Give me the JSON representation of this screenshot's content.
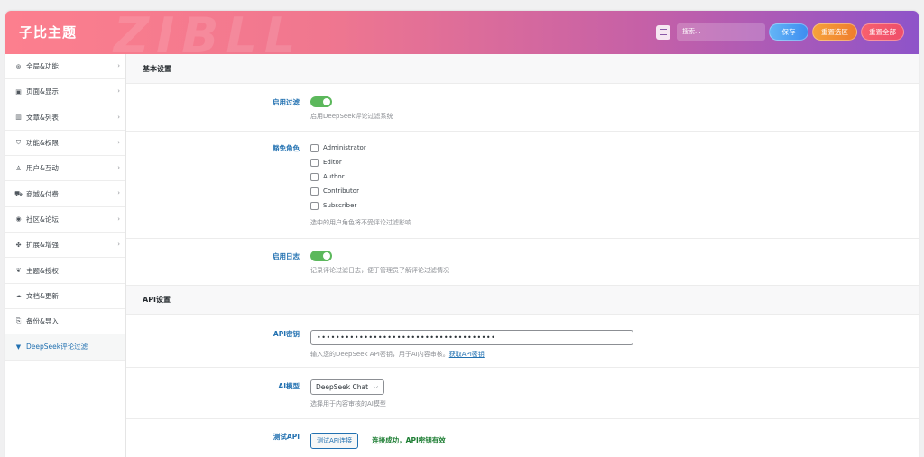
{
  "header": {
    "brand": "子比主题",
    "watermark": "ZIBLL",
    "search_placeholder": "搜索...",
    "save": "保存",
    "reset_section": "重置选区",
    "reset_all": "重置全部"
  },
  "sidebar": {
    "items": [
      {
        "icon": "⊛",
        "label": "全局&功能",
        "chevron": "›"
      },
      {
        "icon": "▣",
        "label": "页面&显示",
        "chevron": "›"
      },
      {
        "icon": "▥",
        "label": "文章&列表",
        "chevron": "›"
      },
      {
        "icon": "⛉",
        "label": "功能&权限",
        "chevron": "›"
      },
      {
        "icon": "♙",
        "label": "用户&互动",
        "chevron": "›"
      },
      {
        "icon": "⛟",
        "label": "商城&付费",
        "chevron": "›"
      },
      {
        "icon": "◉",
        "label": "社区&论坛",
        "chevron": "›"
      },
      {
        "icon": "✤",
        "label": "扩展&增强",
        "chevron": "›"
      },
      {
        "icon": "❦",
        "label": "主题&授权",
        "chevron": ""
      },
      {
        "icon": "☁",
        "label": "文档&更新",
        "chevron": ""
      },
      {
        "icon": "⎘",
        "label": "备份&导入",
        "chevron": ""
      },
      {
        "icon": "▼",
        "label": "DeepSeek评论过滤",
        "chevron": ""
      }
    ],
    "active_index": 11
  },
  "main": {
    "basic_title": "基本设置",
    "enable_filter": {
      "label": "启用过滤",
      "enabled": true,
      "desc": "启用DeepSeek评论过滤系统"
    },
    "exempt_roles": {
      "label": "豁免角色",
      "roles": [
        "Administrator",
        "Editor",
        "Author",
        "Contributor",
        "Subscriber"
      ],
      "desc": "选中的用户角色将不受评论过滤影响"
    },
    "enable_log": {
      "label": "启用日志",
      "enabled": true,
      "desc": "记录评论过滤日志，便于管理员了解评论过滤情况"
    },
    "api_title": "API设置",
    "api_key": {
      "label": "API密钥",
      "value": "••••••••••••••••••••••••••••••••••••••",
      "desc": "输入您的DeepSeek API密钥，用于AI内容审核。",
      "link": "获取API密钥"
    },
    "ai_model": {
      "label": "AI模型",
      "value": "DeepSeek Chat",
      "desc": "选择用于内容审核的AI模型"
    },
    "test_api": {
      "label": "测试API",
      "button": "测试API连接",
      "result": "连接成功，API密钥有效"
    }
  },
  "colors": {
    "accent": "#2271b1",
    "toggle_on": "#5cb85c",
    "success": "#1e7e34",
    "header_start": "#fc7f8e",
    "header_end": "#8e54c9"
  }
}
